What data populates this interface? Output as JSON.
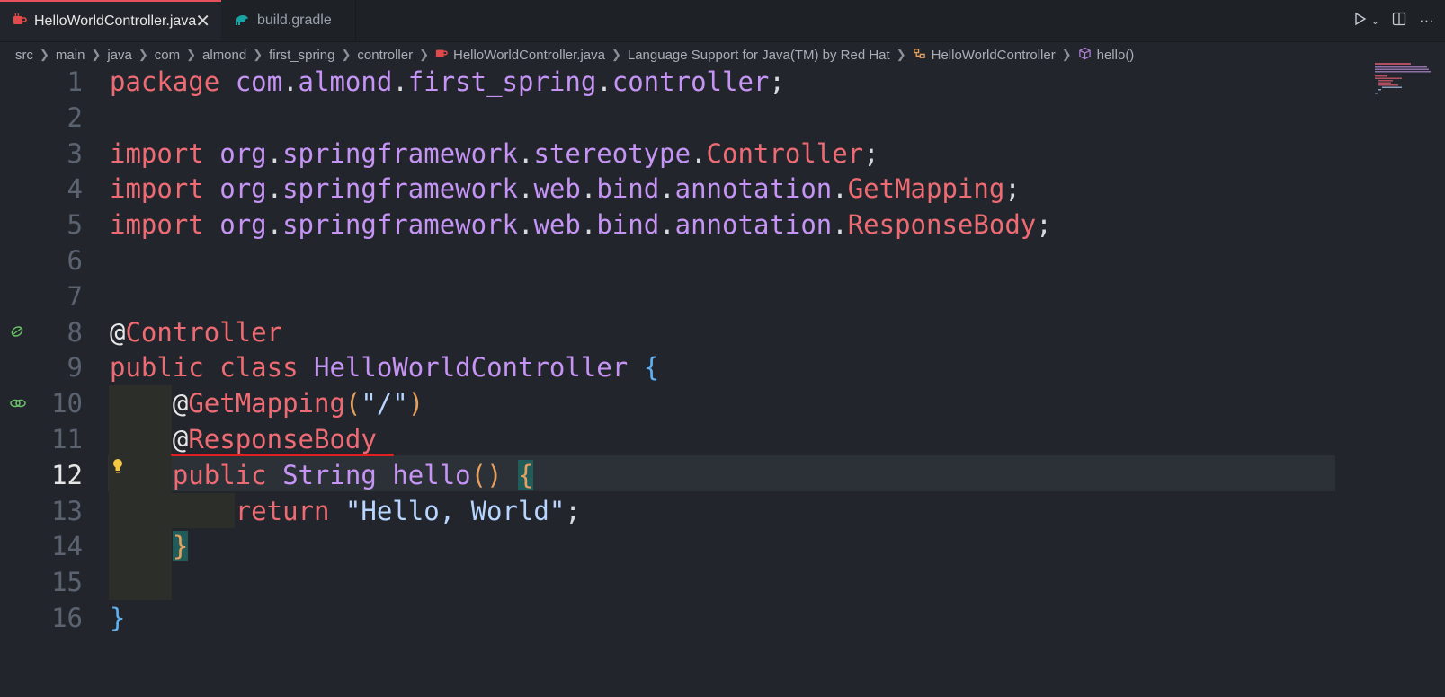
{
  "tabs": [
    {
      "label": "HelloWorldController.java",
      "icon": "java-icon",
      "active": true
    },
    {
      "label": "build.gradle",
      "icon": "gradle-icon",
      "active": false
    }
  ],
  "breadcrumb": [
    "src",
    "main",
    "java",
    "com",
    "almond",
    "first_spring",
    "controller",
    "HelloWorldController.java",
    "Language Support for Java(TM) by Red Hat",
    "HelloWorldController",
    "hello()"
  ],
  "editor": {
    "current_line": 12,
    "line_numbers": [
      "1",
      "2",
      "3",
      "4",
      "5",
      "6",
      "7",
      "8",
      "9",
      "10",
      "11",
      "12",
      "13",
      "14",
      "15",
      "16"
    ],
    "lines": [
      {
        "n": 1,
        "tokens": [
          [
            "kw",
            "package"
          ],
          [
            "plain",
            " "
          ],
          [
            "pk",
            "com"
          ],
          [
            "punct",
            "."
          ],
          [
            "pk",
            "almond"
          ],
          [
            "punct",
            "."
          ],
          [
            "pk",
            "first_spring"
          ],
          [
            "punct",
            "."
          ],
          [
            "pk",
            "controller"
          ],
          [
            "punct",
            ";"
          ]
        ]
      },
      {
        "n": 2,
        "tokens": []
      },
      {
        "n": 3,
        "tokens": [
          [
            "kw",
            "import"
          ],
          [
            "plain",
            " "
          ],
          [
            "pk",
            "org"
          ],
          [
            "punct",
            "."
          ],
          [
            "pk",
            "springframework"
          ],
          [
            "punct",
            "."
          ],
          [
            "pk",
            "stereotype"
          ],
          [
            "punct",
            "."
          ],
          [
            "cls",
            "Controller"
          ],
          [
            "punct",
            ";"
          ]
        ]
      },
      {
        "n": 4,
        "tokens": [
          [
            "kw",
            "import"
          ],
          [
            "plain",
            " "
          ],
          [
            "pk",
            "org"
          ],
          [
            "punct",
            "."
          ],
          [
            "pk",
            "springframework"
          ],
          [
            "punct",
            "."
          ],
          [
            "pk",
            "web"
          ],
          [
            "punct",
            "."
          ],
          [
            "pk",
            "bind"
          ],
          [
            "punct",
            "."
          ],
          [
            "pk",
            "annotation"
          ],
          [
            "punct",
            "."
          ],
          [
            "cls",
            "GetMapping"
          ],
          [
            "punct",
            ";"
          ]
        ]
      },
      {
        "n": 5,
        "tokens": [
          [
            "kw",
            "import"
          ],
          [
            "plain",
            " "
          ],
          [
            "pk",
            "org"
          ],
          [
            "punct",
            "."
          ],
          [
            "pk",
            "springframework"
          ],
          [
            "punct",
            "."
          ],
          [
            "pk",
            "web"
          ],
          [
            "punct",
            "."
          ],
          [
            "pk",
            "bind"
          ],
          [
            "punct",
            "."
          ],
          [
            "pk",
            "annotation"
          ],
          [
            "punct",
            "."
          ],
          [
            "cls",
            "ResponseBody"
          ],
          [
            "punct",
            ";"
          ]
        ]
      },
      {
        "n": 6,
        "tokens": []
      },
      {
        "n": 7,
        "tokens": []
      },
      {
        "n": 8,
        "tokens": [
          [
            "at",
            "@"
          ],
          [
            "cls",
            "Controller"
          ]
        ]
      },
      {
        "n": 9,
        "tokens": [
          [
            "kw",
            "public"
          ],
          [
            "plain",
            " "
          ],
          [
            "kw",
            "class"
          ],
          [
            "plain",
            " "
          ],
          [
            "cls2",
            "HelloWorldController"
          ],
          [
            "plain",
            " "
          ],
          [
            "brace",
            "{"
          ]
        ]
      },
      {
        "n": 10,
        "tokens": [
          [
            "plain",
            "    "
          ],
          [
            "at",
            "@"
          ],
          [
            "cls",
            "GetMapping"
          ],
          [
            "paren",
            "("
          ],
          [
            "str",
            "\"/\""
          ],
          [
            "paren",
            ")"
          ]
        ]
      },
      {
        "n": 11,
        "tokens": [
          [
            "plain",
            "    "
          ],
          [
            "at",
            "@"
          ],
          [
            "cls",
            "ResponseBody"
          ]
        ]
      },
      {
        "n": 12,
        "tokens": [
          [
            "plain",
            "    "
          ],
          [
            "kw",
            "public"
          ],
          [
            "plain",
            " "
          ],
          [
            "cls2",
            "String"
          ],
          [
            "plain",
            " "
          ],
          [
            "cls2",
            "hello"
          ],
          [
            "paren",
            "()"
          ],
          [
            "plain",
            " "
          ],
          [
            "paren",
            "{"
          ]
        ]
      },
      {
        "n": 13,
        "tokens": [
          [
            "plain",
            "        "
          ],
          [
            "kw",
            "return"
          ],
          [
            "plain",
            " "
          ],
          [
            "str",
            "\"Hello, World\""
          ],
          [
            "punct",
            ";"
          ]
        ]
      },
      {
        "n": 14,
        "tokens": [
          [
            "plain",
            "    "
          ],
          [
            "paren",
            "}"
          ]
        ]
      },
      {
        "n": 15,
        "tokens": []
      },
      {
        "n": 16,
        "tokens": [
          [
            "brace",
            "}"
          ]
        ]
      }
    ]
  },
  "colors": {
    "keyword": "#ef6b73",
    "package": "#c594f4",
    "string": "#b7d5ff",
    "brace": "#61afef",
    "paren": "#e5a060",
    "error_squiggle": "#e02020"
  }
}
